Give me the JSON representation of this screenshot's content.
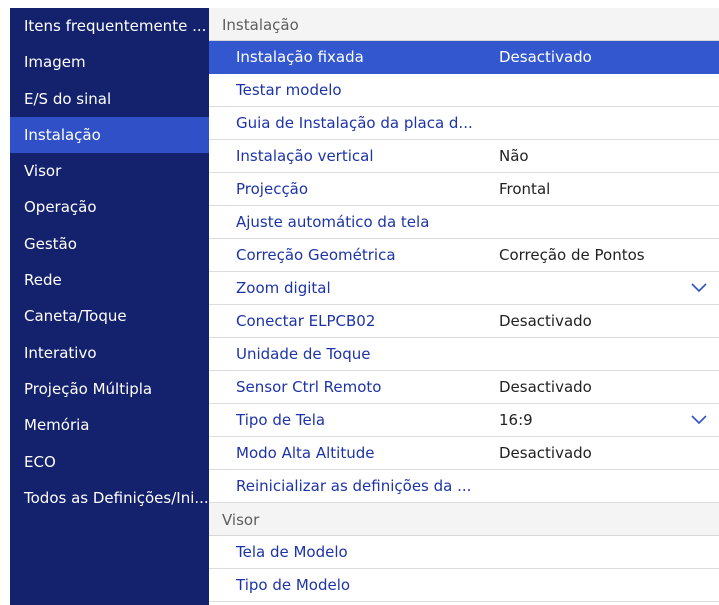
{
  "sidebar": {
    "items": [
      {
        "label": "Itens frequentemente ...",
        "active": false
      },
      {
        "label": "Imagem",
        "active": false
      },
      {
        "label": "E/S do sinal",
        "active": false
      },
      {
        "label": "Instalação",
        "active": true
      },
      {
        "label": "Visor",
        "active": false
      },
      {
        "label": "Operação",
        "active": false
      },
      {
        "label": "Gestão",
        "active": false
      },
      {
        "label": "Rede",
        "active": false
      },
      {
        "label": "Caneta/Toque",
        "active": false
      },
      {
        "label": "Interativo",
        "active": false
      },
      {
        "label": "Projeção Múltipla",
        "active": false
      },
      {
        "label": "Memória",
        "active": false
      },
      {
        "label": "ECO",
        "active": false
      },
      {
        "label": "Todos as Definições/Ini...",
        "active": false
      }
    ]
  },
  "main": {
    "section1": {
      "title": "Instalação",
      "rows": [
        {
          "label": "Instalação fixada",
          "value": "Desactivado",
          "selected": true,
          "dropdown": false
        },
        {
          "label": "Testar modelo",
          "value": "",
          "selected": false,
          "dropdown": false
        },
        {
          "label": "Guia de Instalação da placa d...",
          "value": "",
          "selected": false,
          "dropdown": false
        },
        {
          "label": "Instalação vertical",
          "value": "Não",
          "selected": false,
          "dropdown": false
        },
        {
          "label": "Projecção",
          "value": "Frontal",
          "selected": false,
          "dropdown": false
        },
        {
          "label": "Ajuste automático da tela",
          "value": "",
          "selected": false,
          "dropdown": false
        },
        {
          "label": "Correção Geométrica",
          "value": "Correção de Pontos",
          "selected": false,
          "dropdown": false
        },
        {
          "label": "Zoom digital",
          "value": "",
          "selected": false,
          "dropdown": true
        },
        {
          "label": "Conectar ELPCB02",
          "value": "Desactivado",
          "selected": false,
          "dropdown": false
        },
        {
          "label": "Unidade de Toque",
          "value": "",
          "selected": false,
          "dropdown": false
        },
        {
          "label": "Sensor Ctrl Remoto",
          "value": "Desactivado",
          "selected": false,
          "dropdown": false
        },
        {
          "label": "Tipo de Tela",
          "value": "16:9",
          "selected": false,
          "dropdown": true
        },
        {
          "label": "Modo Alta Altitude",
          "value": "Desactivado",
          "selected": false,
          "dropdown": false
        },
        {
          "label": "Reinicializar as definições da ...",
          "value": "",
          "selected": false,
          "dropdown": false
        }
      ]
    },
    "section2": {
      "title": "Visor",
      "rows": [
        {
          "label": "Tela de Modelo",
          "value": "",
          "selected": false,
          "dropdown": false
        },
        {
          "label": "Tipo de Modelo",
          "value": "",
          "selected": false,
          "dropdown": false
        }
      ]
    }
  },
  "colors": {
    "sidebar_bg": "#14216d",
    "sidebar_active": "#2f50c7",
    "row_selected": "#3357cf",
    "label_text": "#1d34a8",
    "chevron": "#2f50c7"
  }
}
